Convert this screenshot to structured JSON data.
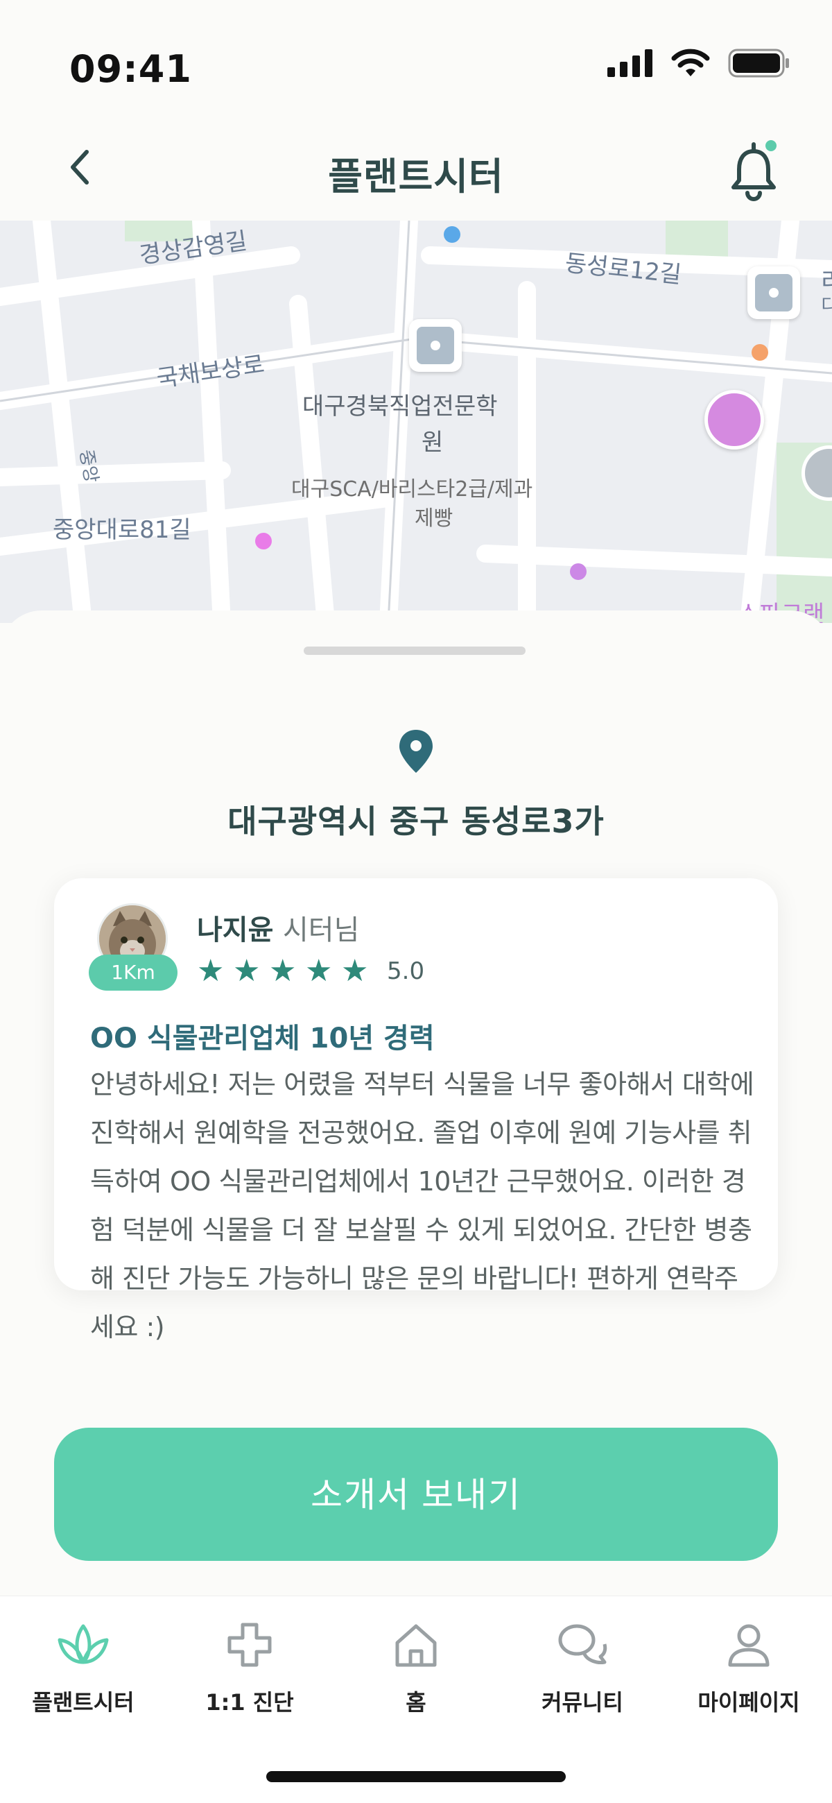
{
  "status_bar": {
    "time": "09:41"
  },
  "header": {
    "title": "플랜트시터"
  },
  "map": {
    "labels": {
      "gyeongsang": "경상감영길",
      "dongseong": "동성로12길",
      "gukchae": "국채보상로",
      "academy_1": "대구경북직업전문학",
      "academy_2": "원",
      "academy_sub_1": "대구SCA/바리스타2급/제과",
      "academy_sub_2": "제빵",
      "jungang_small": "중앙",
      "jungang": "중앙대로81길",
      "edge_1": "스파크랜",
      "edge_2": "리",
      "edge_3": "디"
    }
  },
  "sheet": {
    "address": "대구광역시 중구 동성로3가",
    "card": {
      "distance": "1Km",
      "name": "나지윤",
      "role": "시터님",
      "rating": "5.0",
      "stars": 5,
      "title": "OO 식물관리업체 10년 경력",
      "body": "안녕하세요! 저는 어렸을 적부터 식물을 너무 좋아해서 대학에 진학해서 원예학을 전공했어요. 졸업 이후에 원예 기능사를 취득하여 OO 식물관리업체에서 10년간 근무했어요. 이러한 경험 덕분에 식물을 더 잘 보살필 수 있게 되었어요. 간단한 병충해 진단 가능도 가능하니 많은 문의 바랍니다! 편하게 연락주세요 :)"
    },
    "cta_label": "소개서 보내기"
  },
  "bottom_nav": {
    "items": [
      {
        "label": "플랜트시터",
        "icon": "lotus-icon",
        "active": true
      },
      {
        "label": "1:1 진단",
        "icon": "medical-cross-icon",
        "active": false
      },
      {
        "label": "홈",
        "icon": "home-icon",
        "active": false
      },
      {
        "label": "커뮤니티",
        "icon": "chat-bubbles-icon",
        "active": false
      },
      {
        "label": "마이페이지",
        "icon": "user-icon",
        "active": false
      }
    ]
  },
  "colors": {
    "accent": "#5ccfae",
    "title": "#2f4a4a",
    "star": "#2e8a7a",
    "card_title": "#2f6b79"
  }
}
